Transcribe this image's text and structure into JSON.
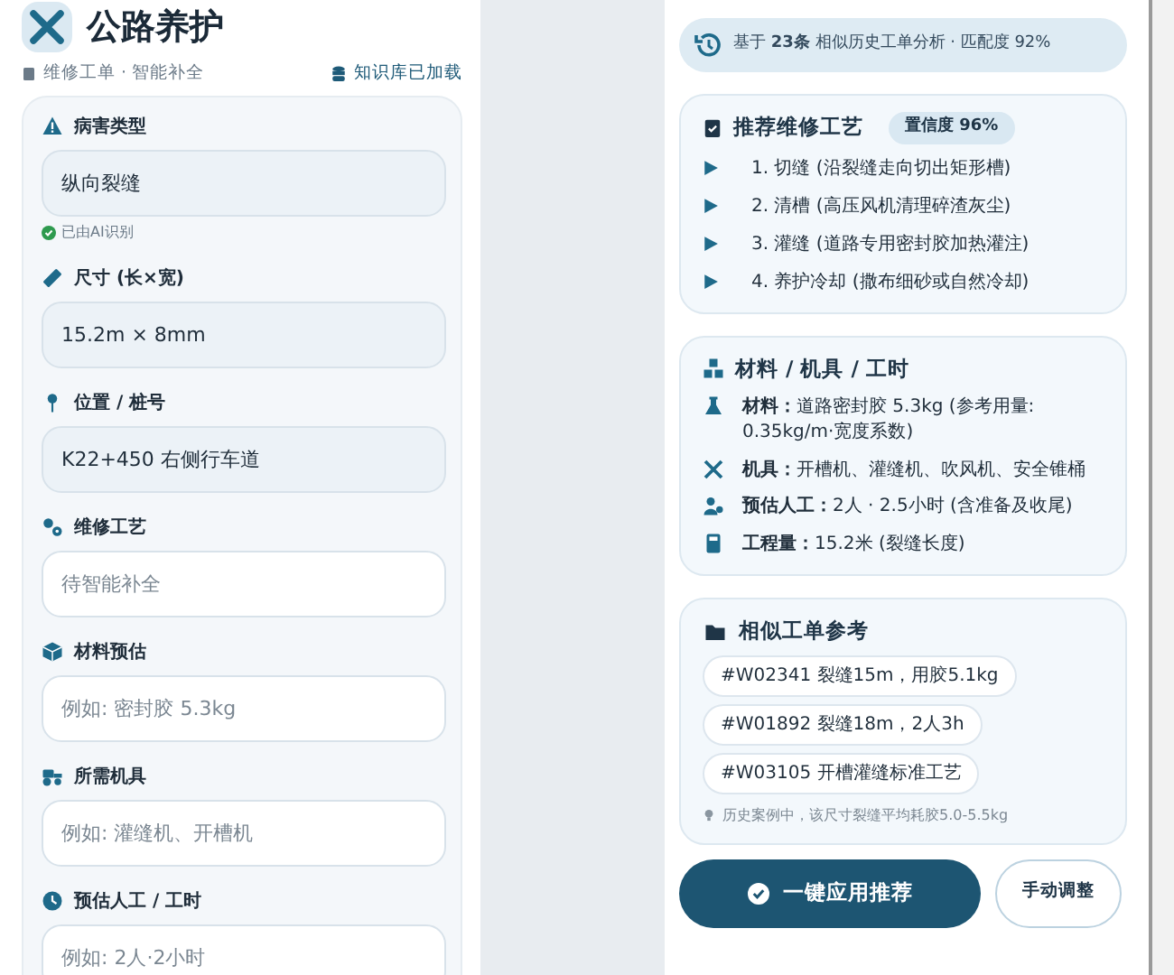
{
  "header": {
    "title": "公路养护",
    "subtitle": "维修工单 · 智能补全",
    "kb_status": "知识库已加载"
  },
  "fields": [
    {
      "label": "病害类型",
      "value": "纵向裂缝",
      "note": "已由AI识别"
    },
    {
      "label": "尺寸 (长×宽)",
      "value": "15.2m × 8mm"
    },
    {
      "label": "位置 / 桩号",
      "value": "K22+450 右侧行车道"
    },
    {
      "label": "维修工艺",
      "placeholder": "待智能补全"
    },
    {
      "label": "材料预估",
      "placeholder": "例如: 密封胶 5.3kg"
    },
    {
      "label": "所需机具",
      "placeholder": "例如: 灌缝机、开槽机"
    },
    {
      "label": "预估人工 / 工时",
      "placeholder": "例如: 2人·2小时"
    }
  ],
  "analysis_banner": "基于 **23条** 相似历史工单分析 · 匹配度 92%",
  "process_card": {
    "title": "推荐维修工艺",
    "confidence": "置信度 96%",
    "steps": [
      "1. 切缝 (沿裂缝走向切出矩形槽)",
      "2. 清槽 (高压风机清理碎渣灰尘)",
      "3. 灌缝 (道路专用密封胶加热灌注)",
      "4. 养护冷却 (撒布细砂或自然冷却)"
    ]
  },
  "resources_card": {
    "title": "材料 / 机具 / 工时",
    "items": [
      {
        "label": "材料：",
        "text": "道路密封胶 5.3kg (参考用量: 0.35kg/m·宽度系数)"
      },
      {
        "label": "机具：",
        "text": "开槽机、灌缝机、吹风机、安全锥桶"
      },
      {
        "label": "预估人工：",
        "text": "2人 · 2.5小时 (含准备及收尾)"
      },
      {
        "label": "工程量：",
        "text": "15.2米 (裂缝长度)"
      }
    ]
  },
  "similar_card": {
    "title": "相似工单参考",
    "orders": [
      "#W02341 裂缝15m，用胶5.1kg",
      "#W01892 裂缝18m，2人3h",
      "#W03105 开槽灌缝标准工艺"
    ],
    "tip": "历史案例中，该尺寸裂缝平均耗胶5.0-5.5kg"
  },
  "buttons": {
    "apply": "一键应用推荐",
    "manual": "手动调整"
  }
}
